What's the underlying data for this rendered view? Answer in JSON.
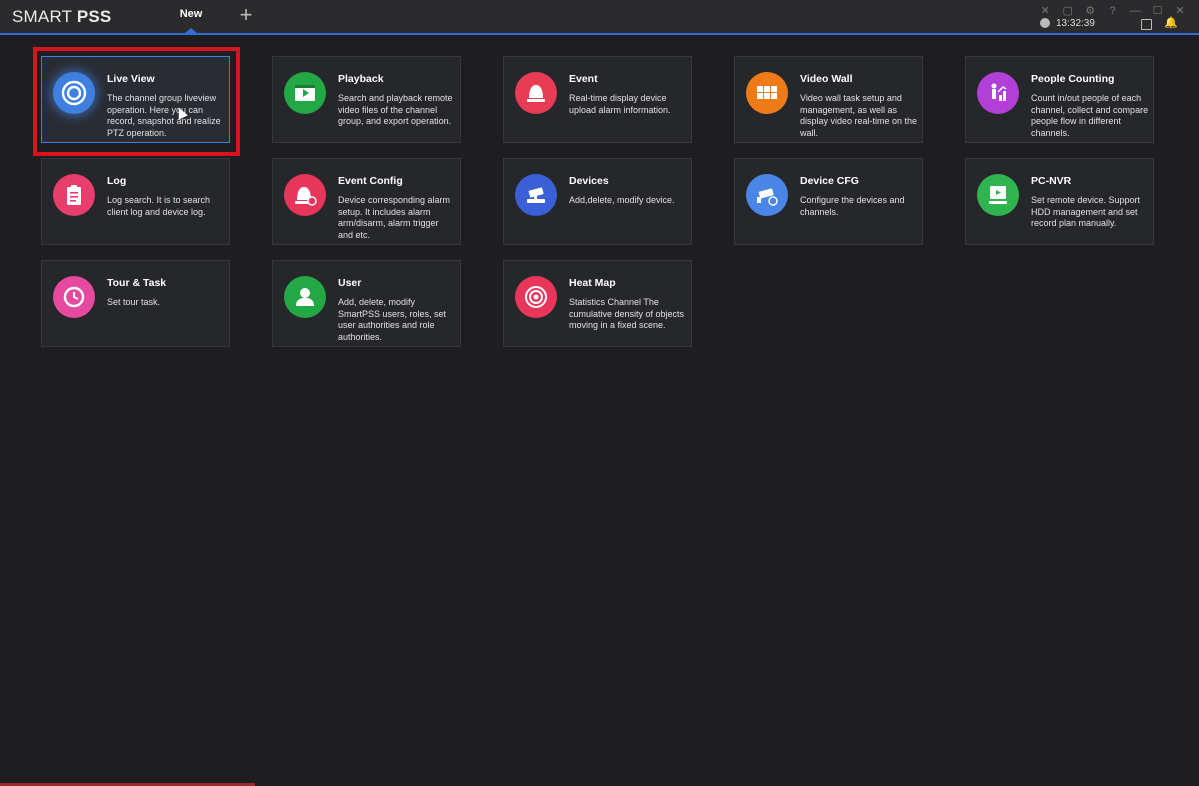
{
  "app": {
    "brand_light": "SMART ",
    "brand_bold": "PSS"
  },
  "tabs": {
    "new_label": "New",
    "add_label": "+"
  },
  "system": {
    "icons": [
      "close-icon",
      "lock-icon",
      "gear-icon",
      "help-icon",
      "minimize-icon",
      "maximize-icon",
      "close-window-icon"
    ],
    "clock": "13:32:39"
  },
  "cards": [
    {
      "id": "live-view",
      "title": "Live View",
      "desc": "The channel group liveview operation. Here you can record, snapshot and realize PTZ operation.",
      "color": "#3f7fe0",
      "icon": "live-view-icon"
    },
    {
      "id": "playback",
      "title": "Playback",
      "desc": "Search and playback remote video files of the channel group, and export operation.",
      "color": "#23a846",
      "icon": "playback-icon"
    },
    {
      "id": "event",
      "title": "Event",
      "desc": "Real-time display device upload alarm information.",
      "color": "#e83b54",
      "icon": "alarm-icon"
    },
    {
      "id": "video-wall",
      "title": "Video Wall",
      "desc": "Video wall task setup and management, as well as display video real-time on the wall.",
      "color": "#ef7a18",
      "icon": "video-wall-icon"
    },
    {
      "id": "people-counting",
      "title": "People Counting",
      "desc": "Count in/out people of each channel, collect and compare people flow in different channels.",
      "color": "#b23fd8",
      "icon": "people-counting-icon"
    },
    {
      "id": "log",
      "title": "Log",
      "desc": "Log search. It is to search client log and device log.",
      "color": "#e83e6e",
      "icon": "clipboard-icon"
    },
    {
      "id": "event-config",
      "title": "Event Config",
      "desc": "Device corresponding alarm setup. It includes alarm arm/disarm, alarm trigger and etc.",
      "color": "#e8365a",
      "icon": "alarm-config-icon"
    },
    {
      "id": "devices",
      "title": "Devices",
      "desc": "Add,delete, modify device.",
      "color": "#3b5fd6",
      "icon": "camera-device-icon"
    },
    {
      "id": "device-cfg",
      "title": "Device CFG",
      "desc": "Configure the devices and channels.",
      "color": "#4a86e8",
      "icon": "camera-config-icon"
    },
    {
      "id": "pc-nvr",
      "title": "PC-NVR",
      "desc": "Set remote device. Support HDD management and set record plan manually.",
      "color": "#2fb44f",
      "icon": "pc-nvr-icon"
    },
    {
      "id": "tour-task",
      "title": "Tour & Task",
      "desc": "Set tour task.",
      "color": "#e64aa0",
      "icon": "tour-clock-icon"
    },
    {
      "id": "user",
      "title": "User",
      "desc": "Add, delete, modify SmartPSS users, roles, set user authorities and role authorities.",
      "color": "#23a846",
      "icon": "user-icon"
    },
    {
      "id": "heat-map",
      "title": "Heat Map",
      "desc": "Statistics Channel The cumulative density of objects moving in a fixed scene.",
      "color": "#e8365a",
      "icon": "heat-map-icon"
    }
  ],
  "highlight_color": "#d8141c"
}
